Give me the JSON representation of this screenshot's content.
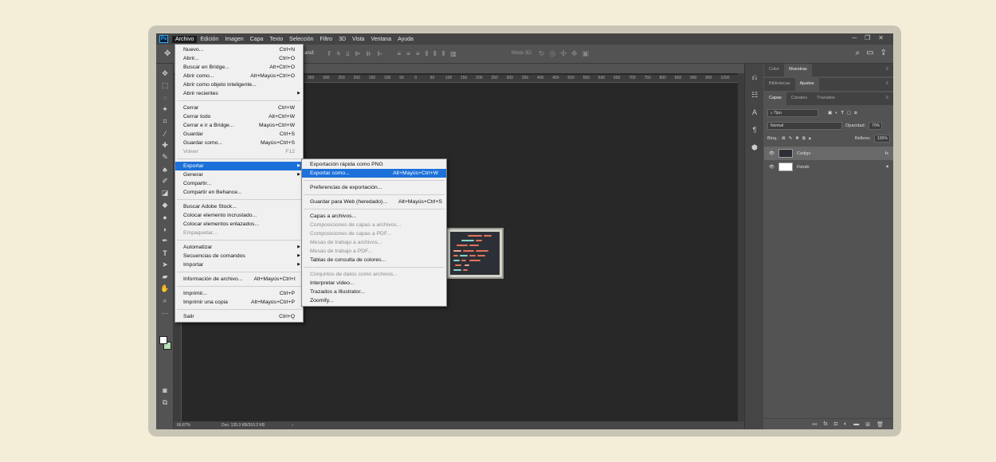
{
  "app": {
    "logo": "Ps"
  },
  "menubar": [
    "Archivo",
    "Edición",
    "Imagen",
    "Capa",
    "Texto",
    "Selección",
    "Filtro",
    "3D",
    "Vista",
    "Ventana",
    "Ayuda"
  ],
  "options": {
    "transform_label": "ransf.",
    "mode_3d": "Modo 3D:"
  },
  "archivo_menu": [
    {
      "label": "Nuevo...",
      "shortcut": "Ctrl+N"
    },
    {
      "label": "Abrir...",
      "shortcut": "Ctrl+O"
    },
    {
      "label": "Buscar en Bridge...",
      "shortcut": "Alt+Ctrl+O"
    },
    {
      "label": "Abrir como...",
      "shortcut": "Alt+Mayús+Ctrl+O"
    },
    {
      "label": "Abrir como objeto inteligente...",
      "shortcut": ""
    },
    {
      "label": "Abrir recientes",
      "shortcut": "",
      "submenu": true
    },
    {
      "sep": true
    },
    {
      "label": "Cerrar",
      "shortcut": "Ctrl+W"
    },
    {
      "label": "Cerrar todo",
      "shortcut": "Alt+Ctrl+W"
    },
    {
      "label": "Cerrar e ir a Bridge...",
      "shortcut": "Mayús+Ctrl+W"
    },
    {
      "label": "Guardar",
      "shortcut": "Ctrl+S"
    },
    {
      "label": "Guardar como...",
      "shortcut": "Mayús+Ctrl+S"
    },
    {
      "label": "Volver",
      "shortcut": "F12",
      "disabled": true
    },
    {
      "sep": true
    },
    {
      "label": "Exportar",
      "shortcut": "",
      "submenu": true,
      "highlight": true
    },
    {
      "label": "Generar",
      "shortcut": "",
      "submenu": true
    },
    {
      "label": "Compartir...",
      "shortcut": ""
    },
    {
      "label": "Compartir en Behance...",
      "shortcut": ""
    },
    {
      "sep": true
    },
    {
      "label": "Buscar Adobe Stock...",
      "shortcut": ""
    },
    {
      "label": "Colocar elemento incrustado...",
      "shortcut": ""
    },
    {
      "label": "Colocar elementos enlazados...",
      "shortcut": ""
    },
    {
      "label": "Empaquetar...",
      "shortcut": "",
      "disabled": true
    },
    {
      "sep": true
    },
    {
      "label": "Automatizar",
      "shortcut": "",
      "submenu": true
    },
    {
      "label": "Secuencias de comandos",
      "shortcut": "",
      "submenu": true
    },
    {
      "label": "Importar",
      "shortcut": "",
      "submenu": true
    },
    {
      "sep": true
    },
    {
      "label": "Información de archivo...",
      "shortcut": "Alt+Mayús+Ctrl+I"
    },
    {
      "sep": true
    },
    {
      "label": "Imprimir...",
      "shortcut": "Ctrl+P"
    },
    {
      "label": "Imprimir una copia",
      "shortcut": "Alt+Mayús+Ctrl+P"
    },
    {
      "sep": true
    },
    {
      "label": "Salir",
      "shortcut": "Ctrl+Q"
    }
  ],
  "exportar_submenu": [
    {
      "label": "Exportación rápida como PNG",
      "shortcut": ""
    },
    {
      "label": "Exportar como...",
      "shortcut": "Alt+Mayús+Ctrl+W",
      "highlight": true
    },
    {
      "sep": true
    },
    {
      "label": "Preferencias de exportación...",
      "shortcut": ""
    },
    {
      "sep": true
    },
    {
      "label": "Guardar para Web (heredado)...",
      "shortcut": "Alt+Mayús+Ctrl+S"
    },
    {
      "sep": true
    },
    {
      "label": "Capas a archivos...",
      "shortcut": ""
    },
    {
      "label": "Composiciones de capas a archivos...",
      "shortcut": "",
      "disabled": true
    },
    {
      "label": "Composiciones de capas a PDF...",
      "shortcut": "",
      "disabled": true
    },
    {
      "label": "Mesas de trabajo a archivos...",
      "shortcut": "",
      "disabled": true
    },
    {
      "label": "Mesas de trabajo a PDF...",
      "shortcut": "",
      "disabled": true
    },
    {
      "label": "Tablas de consulta de colores...",
      "shortcut": ""
    },
    {
      "sep": true
    },
    {
      "label": "Conjuntos de datos como archivos...",
      "shortcut": "",
      "disabled": true
    },
    {
      "label": "Interpretar vídeo...",
      "shortcut": ""
    },
    {
      "label": "Trazados a Illustrator...",
      "shortcut": ""
    },
    {
      "label": "Zoomify...",
      "shortcut": ""
    }
  ],
  "ruler_ticks": [
    "350",
    "300",
    "250",
    "200",
    "150",
    "100",
    "50",
    "0",
    "50",
    "100",
    "150",
    "200",
    "250",
    "300",
    "350",
    "400",
    "450",
    "500",
    "550",
    "600",
    "650",
    "700",
    "750",
    "800",
    "850",
    "900",
    "950",
    "1000"
  ],
  "status": {
    "zoom": "66.67%",
    "doc": "Doc: 135.3 KB/316.2 KB"
  },
  "panels": {
    "top_tabs": [
      "Color",
      "Muestras"
    ],
    "mid_tabs": [
      "Bibliotecas",
      "Ajustes"
    ],
    "layer_tabs": [
      "Capas",
      "Canales",
      "Trazados"
    ],
    "filter_kind": "Tipo",
    "blend_mode": "Normal",
    "opacity_label": "Opacidad:",
    "opacity_value": "70%",
    "lock_label": "Bloq.:",
    "fill_label": "Relleno:",
    "fill_value": "100%",
    "layers": [
      {
        "name": "Codigo",
        "selected": true,
        "fx": "fx"
      },
      {
        "name": "Fondo",
        "selected": false
      }
    ]
  },
  "colors": {
    "highlight": "#1c70d9",
    "code_red": "#e5735a",
    "code_teal": "#8ad3c8",
    "code_pink": "#f1a191"
  }
}
